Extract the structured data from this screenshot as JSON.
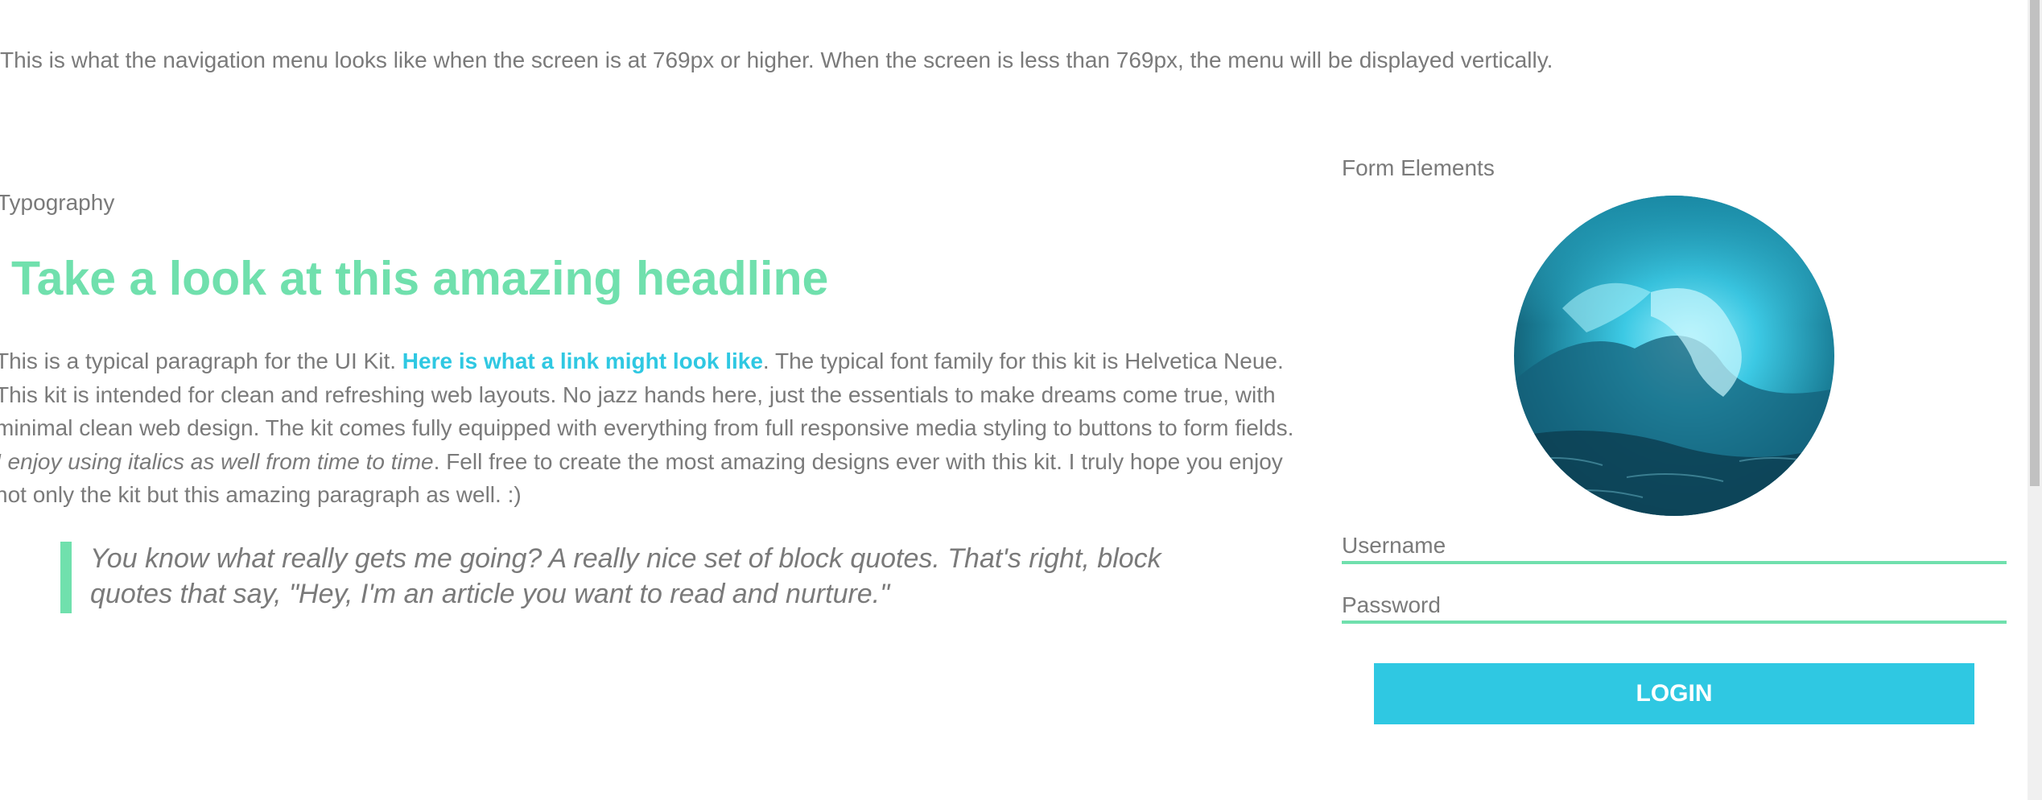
{
  "nav_note": "This is what the navigation menu looks like when the screen is at 769px or higher. When the screen is less than 769px, the menu will be displayed vertically.",
  "typography": {
    "section_label": "Typography",
    "headline": "Take a look at this amazing headline",
    "paragraph": {
      "intro": "This is a typical paragraph for the UI Kit. ",
      "link_text": "Here is what a link might look like",
      "middle": ". The typical font family for this kit is Helvetica Neue. This kit is intended for clean and refreshing web layouts. No jazz hands here, just the essentials to make dreams come true, with minimal clean web design. The kit comes fully equipped with everything from full responsive media styling to buttons to form fields. ",
      "italic": "I enjoy using italics as well from time to time",
      "end": ". Fell free to create the most amazing designs ever with this kit. I truly hope you enjoy not only the kit but this amazing paragraph as well. :)"
    },
    "blockquote": "You know what really gets me going? A really nice set of block quotes. That's right, block quotes that say, \"Hey, I'm an article you want to read and nurture.\""
  },
  "form": {
    "section_label": "Form Elements",
    "avatar_icon": "ocean-wave-image",
    "username_placeholder": "Username",
    "password_placeholder": "Password",
    "login_label": "LOGIN"
  },
  "colors": {
    "accent_green": "#70e0ad",
    "accent_blue": "#2fc8e2",
    "text_gray": "#7a7a7a"
  }
}
